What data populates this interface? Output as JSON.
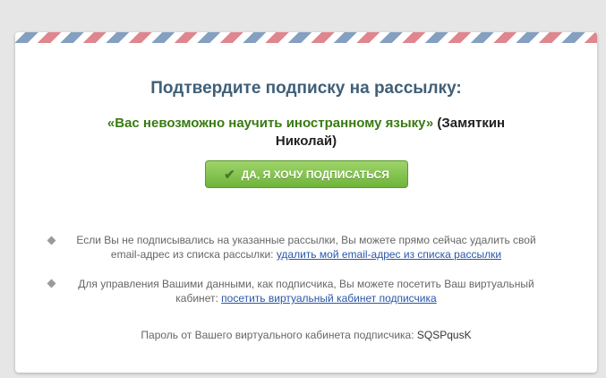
{
  "header": {
    "title": "Подтвердите подписку на рассылку:",
    "list_name": "«Вас невозможно научить иностранному языку»",
    "author": "(Замяткин Николай)"
  },
  "confirm_button": {
    "label": "ДА, Я ХОЧУ ПОДПИСАТЬСЯ",
    "icon": "check-icon"
  },
  "unsubscribe": {
    "text": "Если Вы не подписывались на указанные рассылки, Вы можете прямо сейчас удалить свой email-адрес из списка рассылки:",
    "link": "удалить мой email-адрес из списка рассылки"
  },
  "cabinet": {
    "text": "Для управления Вашими данными, как подписчика, Вы можете посетить Ваш виртуальный кабинет:",
    "link": "посетить виртуальный кабинет подписчика"
  },
  "password": {
    "text": "Пароль от Вашего виртуального кабинета подписчика:",
    "value": "SQSPqusK"
  },
  "colors": {
    "title": "#3f5f78",
    "list_name": "#3a7a12",
    "button": "#7cc046",
    "link": "#2a57a8"
  }
}
